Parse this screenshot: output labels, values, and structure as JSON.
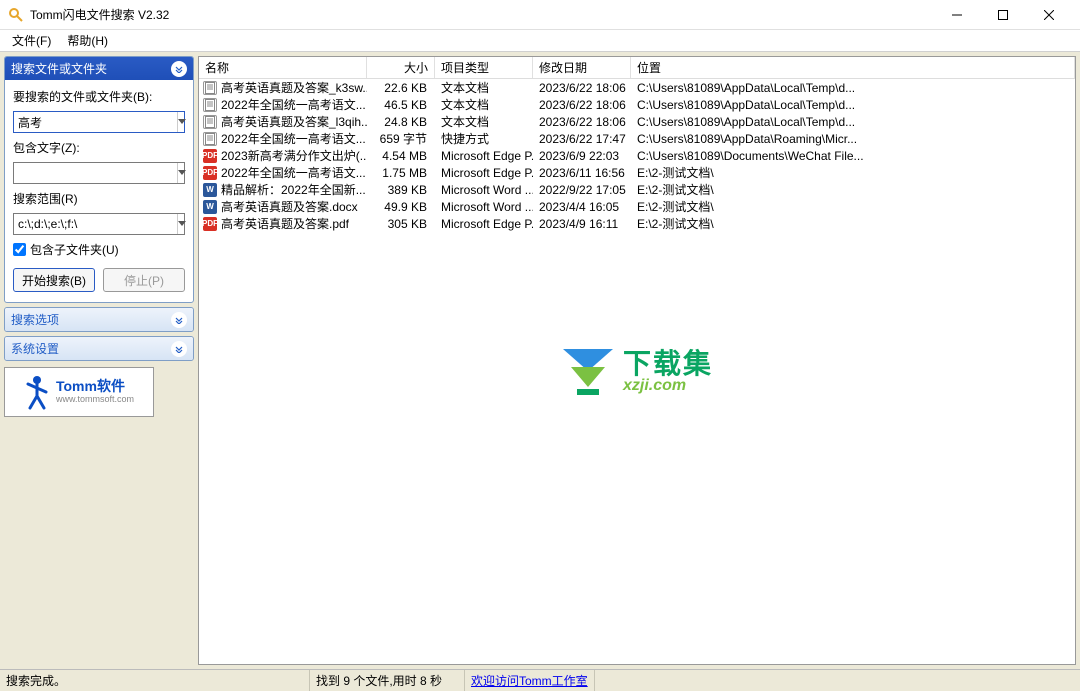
{
  "window": {
    "title": "Tomm闪电文件搜索 V2.32"
  },
  "menu": {
    "file": "文件(F)",
    "help": "帮助(H)"
  },
  "sidebar": {
    "panel_search": {
      "title": "搜索文件或文件夹",
      "label_target": "要搜索的文件或文件夹(B):",
      "value_target": "高考",
      "label_contains": "包含文字(Z):",
      "value_contains": "",
      "label_scope": "搜索范围(R)",
      "value_scope": "c:\\;d:\\;e:\\;f:\\",
      "checkbox_sub": "包含子文件夹(U)",
      "btn_start": "开始搜索(B)",
      "btn_stop": "停止(P)"
    },
    "panel_options": {
      "title": "搜索选项"
    },
    "panel_system": {
      "title": "系统设置"
    },
    "logo": {
      "line1": "Tomm软件",
      "line2": "www.tommsoft.com"
    }
  },
  "columns": {
    "name": "名称",
    "size": "大小",
    "type": "项目类型",
    "date": "修改日期",
    "loc": "位置"
  },
  "rows": [
    {
      "icon": "txt",
      "name": "高考英语真题及答案_k3sw...",
      "size": "22.6 KB",
      "type": "文本文档",
      "date": "2023/6/22 18:06",
      "loc": "C:\\Users\\81089\\AppData\\Local\\Temp\\d..."
    },
    {
      "icon": "txt",
      "name": "2022年全国统一高考语文...",
      "size": "46.5 KB",
      "type": "文本文档",
      "date": "2023/6/22 18:06",
      "loc": "C:\\Users\\81089\\AppData\\Local\\Temp\\d..."
    },
    {
      "icon": "txt",
      "name": "高考英语真题及答案_l3qih...",
      "size": "24.8 KB",
      "type": "文本文档",
      "date": "2023/6/22 18:06",
      "loc": "C:\\Users\\81089\\AppData\\Local\\Temp\\d..."
    },
    {
      "icon": "lnk",
      "name": "2022年全国统一高考语文...",
      "size": "659 字节",
      "type": "快捷方式",
      "date": "2023/6/22 17:47",
      "loc": "C:\\Users\\81089\\AppData\\Roaming\\Micr..."
    },
    {
      "icon": "pdf",
      "name": "2023新高考满分作文出炉(...",
      "size": "4.54 MB",
      "type": "Microsoft Edge P...",
      "date": "2023/6/9 22:03",
      "loc": "C:\\Users\\81089\\Documents\\WeChat File..."
    },
    {
      "icon": "pdf",
      "name": "2022年全国统一高考语文...",
      "size": "1.75 MB",
      "type": "Microsoft Edge P...",
      "date": "2023/6/11 16:56",
      "loc": "E:\\2-测试文档\\"
    },
    {
      "icon": "docx",
      "name": "精品解析：2022年全国新...",
      "size": "389 KB",
      "type": "Microsoft Word ...",
      "date": "2022/9/22 17:05",
      "loc": "E:\\2-测试文档\\"
    },
    {
      "icon": "docx",
      "name": "高考英语真题及答案.docx",
      "size": "49.9 KB",
      "type": "Microsoft Word ...",
      "date": "2023/4/4 16:05",
      "loc": "E:\\2-测试文档\\"
    },
    {
      "icon": "pdf",
      "name": "高考英语真题及答案.pdf",
      "size": "305 KB",
      "type": "Microsoft Edge P...",
      "date": "2023/4/9 16:11",
      "loc": "E:\\2-测试文档\\"
    }
  ],
  "watermark": {
    "line1": "下载集",
    "line2": "xzji.com"
  },
  "status": {
    "done": "搜索完成。",
    "count": "找到 9 个文件,用时 8 秒",
    "link": "欢迎访问Tomm工作室"
  }
}
